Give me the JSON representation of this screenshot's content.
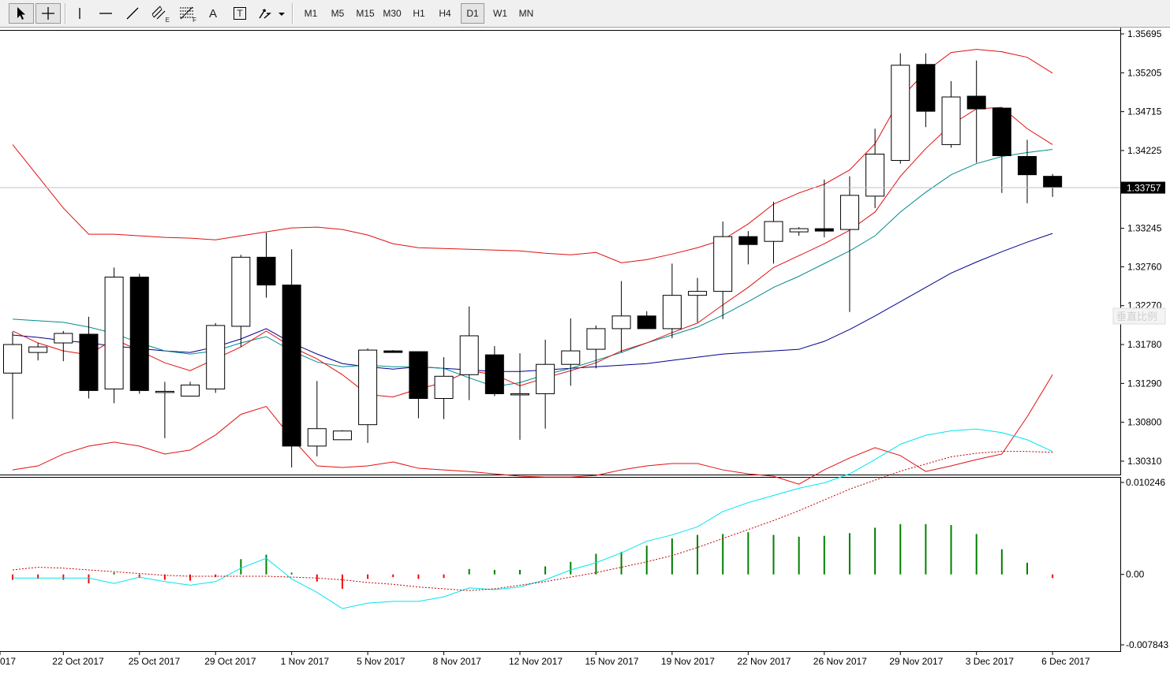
{
  "toolbar": {
    "tools": [
      {
        "name": "cursor-tool",
        "icon": "arrow-cursor-icon"
      },
      {
        "name": "crosshair-tool",
        "icon": "crosshair-icon"
      },
      {
        "name": "vertical-line-tool",
        "icon": "vertical-line-icon"
      },
      {
        "name": "horizontal-line-tool",
        "icon": "horizontal-line-icon"
      },
      {
        "name": "trendline-tool",
        "icon": "trendline-icon"
      },
      {
        "name": "equidistant-channel-tool",
        "icon": "channel-icon",
        "sub": "E"
      },
      {
        "name": "fibonacci-tool",
        "icon": "fibonacci-icon",
        "sub": "F"
      },
      {
        "name": "text-tool",
        "icon": "text-icon",
        "label": "A"
      },
      {
        "name": "text-label-tool",
        "icon": "text-label-icon",
        "label": "T"
      },
      {
        "name": "arrows-tool",
        "icon": "arrows-dropdown-icon"
      }
    ],
    "timeframes": [
      "M1",
      "M5",
      "M15",
      "M30",
      "H1",
      "H4",
      "D1",
      "W1",
      "MN"
    ],
    "active_timeframe": "D1"
  },
  "price_axis": {
    "labels": [
      "1.35695",
      "1.35205",
      "1.34715",
      "1.34225",
      "1.33245",
      "1.32760",
      "1.32270",
      "1.31780",
      "1.31290",
      "1.30800",
      "1.30310"
    ],
    "current_price": "1.33757",
    "watermark": "垂直比例"
  },
  "indicator_axis": {
    "labels": [
      "0.010246",
      "0.00",
      "-0.007843"
    ]
  },
  "time_axis": {
    "labels": [
      "017",
      "22 Oct 2017",
      "25 Oct 2017",
      "29 Oct 2017",
      "1 Nov 2017",
      "5 Nov 2017",
      "8 Nov 2017",
      "12 Nov 2017",
      "15 Nov 2017",
      "19 Nov 2017",
      "22 Nov 2017",
      "26 Nov 2017",
      "29 Nov 2017",
      "3 Dec 2017",
      "6 Dec 2017"
    ]
  },
  "colors": {
    "bollinger": "#e01010",
    "ma_teal": "#008b8b",
    "ma_navy": "#00008b",
    "histogram_up": "#008000",
    "histogram_down": "#ff0000",
    "signal_cyan": "#00e5ee",
    "signal_dotted": "#c00000",
    "bull_candle": "#ffffff",
    "bear_candle": "#000000"
  },
  "chart_data": {
    "type": "candlestick",
    "symbol_timeframe": "D1",
    "ylim": [
      1.3011,
      1.358
    ],
    "candles": [
      {
        "o": 1.3142,
        "h": 1.3194,
        "l": 1.3084,
        "c": 1.3178
      },
      {
        "o": 1.3168,
        "h": 1.318,
        "l": 1.3158,
        "c": 1.3175
      },
      {
        "o": 1.318,
        "h": 1.3195,
        "l": 1.3157,
        "c": 1.3192
      },
      {
        "o": 1.3191,
        "h": 1.3213,
        "l": 1.311,
        "c": 1.312
      },
      {
        "o": 1.3122,
        "h": 1.3275,
        "l": 1.3104,
        "c": 1.3263
      },
      {
        "o": 1.3263,
        "h": 1.3267,
        "l": 1.3116,
        "c": 1.312
      },
      {
        "o": 1.3119,
        "h": 1.3131,
        "l": 1.306,
        "c": 1.3119
      },
      {
        "o": 1.3113,
        "h": 1.3131,
        "l": 1.3113,
        "c": 1.3127
      },
      {
        "o": 1.3122,
        "h": 1.3205,
        "l": 1.3117,
        "c": 1.3202
      },
      {
        "o": 1.3201,
        "h": 1.3291,
        "l": 1.3175,
        "c": 1.3288
      },
      {
        "o": 1.3288,
        "h": 1.3319,
        "l": 1.3237,
        "c": 1.3253
      },
      {
        "o": 1.3253,
        "h": 1.3298,
        "l": 1.3023,
        "c": 1.305
      },
      {
        "o": 1.305,
        "h": 1.3132,
        "l": 1.3037,
        "c": 1.3072
      },
      {
        "o": 1.3058,
        "h": 1.307,
        "l": 1.3058,
        "c": 1.3069
      },
      {
        "o": 1.3077,
        "h": 1.3173,
        "l": 1.3054,
        "c": 1.3171
      },
      {
        "o": 1.317,
        "h": 1.3171,
        "l": 1.3168,
        "c": 1.3168
      },
      {
        "o": 1.3169,
        "h": 1.3169,
        "l": 1.3085,
        "c": 1.311
      },
      {
        "o": 1.311,
        "h": 1.3162,
        "l": 1.3084,
        "c": 1.3138
      },
      {
        "o": 1.314,
        "h": 1.3226,
        "l": 1.3108,
        "c": 1.3189
      },
      {
        "o": 1.3165,
        "h": 1.3176,
        "l": 1.3113,
        "c": 1.3116
      },
      {
        "o": 1.3116,
        "h": 1.3167,
        "l": 1.3058,
        "c": 1.3116
      },
      {
        "o": 1.3116,
        "h": 1.3184,
        "l": 1.3072,
        "c": 1.3153
      },
      {
        "o": 1.3153,
        "h": 1.3211,
        "l": 1.3126,
        "c": 1.317
      },
      {
        "o": 1.3172,
        "h": 1.3202,
        "l": 1.3148,
        "c": 1.3198
      },
      {
        "o": 1.3198,
        "h": 1.3258,
        "l": 1.3168,
        "c": 1.3214
      },
      {
        "o": 1.3214,
        "h": 1.322,
        "l": 1.3198,
        "c": 1.3198
      },
      {
        "o": 1.3198,
        "h": 1.328,
        "l": 1.3186,
        "c": 1.324
      },
      {
        "o": 1.324,
        "h": 1.3262,
        "l": 1.3206,
        "c": 1.3245
      },
      {
        "o": 1.3245,
        "h": 1.3333,
        "l": 1.321,
        "c": 1.3314
      },
      {
        "o": 1.3314,
        "h": 1.3321,
        "l": 1.3279,
        "c": 1.3304
      },
      {
        "o": 1.3308,
        "h": 1.3358,
        "l": 1.328,
        "c": 1.3333
      },
      {
        "o": 1.332,
        "h": 1.3326,
        "l": 1.3315,
        "c": 1.3324
      },
      {
        "o": 1.3324,
        "h": 1.3386,
        "l": 1.3313,
        "c": 1.3321
      },
      {
        "o": 1.3323,
        "h": 1.339,
        "l": 1.3219,
        "c": 1.3366
      },
      {
        "o": 1.3365,
        "h": 1.345,
        "l": 1.335,
        "c": 1.3418
      },
      {
        "o": 1.341,
        "h": 1.3545,
        "l": 1.3406,
        "c": 1.353
      },
      {
        "o": 1.3531,
        "h": 1.3545,
        "l": 1.3452,
        "c": 1.3472
      },
      {
        "o": 1.343,
        "h": 1.351,
        "l": 1.3426,
        "c": 1.349
      },
      {
        "o": 1.3491,
        "h": 1.3536,
        "l": 1.3407,
        "c": 1.3475
      },
      {
        "o": 1.3476,
        "h": 1.3475,
        "l": 1.3369,
        "c": 1.3416
      },
      {
        "o": 1.3415,
        "h": 1.3436,
        "l": 1.3356,
        "c": 1.3392
      },
      {
        "o": 1.339,
        "h": 1.3393,
        "l": 1.3364,
        "c": 1.3376
      }
    ],
    "bollinger_upper": [
      1.343,
      1.339,
      1.335,
      1.3317,
      1.3317,
      1.3315,
      1.3313,
      1.3312,
      1.331,
      1.3315,
      1.332,
      1.3325,
      1.3326,
      1.3323,
      1.3316,
      1.3305,
      1.33,
      1.3299,
      1.3298,
      1.3297,
      1.3296,
      1.3293,
      1.3291,
      1.3294,
      1.3281,
      1.3285,
      1.3292,
      1.33,
      1.331,
      1.333,
      1.3355,
      1.3369,
      1.338,
      1.3398,
      1.3431,
      1.3488,
      1.3522,
      1.3546,
      1.355,
      1.3547,
      1.354,
      1.352
    ],
    "bollinger_middle": [
      1.319,
      1.3187,
      1.3183,
      1.318,
      1.3176,
      1.3173,
      1.317,
      1.3168,
      1.3175,
      1.3185,
      1.3198,
      1.318,
      1.3166,
      1.3154,
      1.315,
      1.3147,
      1.315,
      1.3148,
      1.3146,
      1.3144,
      1.3144,
      1.3146,
      1.3148,
      1.315,
      1.3152,
      1.3154,
      1.3158,
      1.3162,
      1.3166,
      1.3168,
      1.317,
      1.3172,
      1.3182,
      1.3197,
      1.3214,
      1.3232,
      1.325,
      1.3268,
      1.3282,
      1.3295,
      1.3307,
      1.3318
    ],
    "bollinger_lower": [
      1.302,
      1.3025,
      1.304,
      1.305,
      1.3055,
      1.305,
      1.304,
      1.3045,
      1.3064,
      1.309,
      1.31,
      1.306,
      1.3025,
      1.3023,
      1.3025,
      1.303,
      1.3022,
      1.302,
      1.3018,
      1.3015,
      1.3012,
      1.3011,
      1.3011,
      1.3013,
      1.302,
      1.3025,
      1.3028,
      1.3028,
      1.302,
      1.3015,
      1.3012,
      1.3002,
      1.302,
      1.3035,
      1.3048,
      1.3038,
      1.3018,
      1.3025,
      1.3033,
      1.304,
      1.3087,
      1.314
    ],
    "ma_teal": [
      1.321,
      1.3208,
      1.3206,
      1.32,
      1.3192,
      1.318,
      1.317,
      1.3166,
      1.317,
      1.318,
      1.3188,
      1.317,
      1.3156,
      1.315,
      1.3152,
      1.315,
      1.315,
      1.3148,
      1.3136,
      1.3125,
      1.313,
      1.314,
      1.3148,
      1.3158,
      1.3168,
      1.318,
      1.319,
      1.32,
      1.3215,
      1.3232,
      1.325,
      1.3264,
      1.328,
      1.3296,
      1.3315,
      1.3345,
      1.337,
      1.3392,
      1.3406,
      1.3415,
      1.342,
      1.3424
    ],
    "ma_red": [
      1.3195,
      1.318,
      1.317,
      1.3165,
      1.3185,
      1.317,
      1.3155,
      1.3145,
      1.316,
      1.3175,
      1.3195,
      1.3175,
      1.316,
      1.314,
      1.3115,
      1.3112,
      1.3122,
      1.313,
      1.3145,
      1.314,
      1.3126,
      1.3136,
      1.3145,
      1.3155,
      1.317,
      1.318,
      1.3193,
      1.3205,
      1.3228,
      1.325,
      1.3275,
      1.329,
      1.3305,
      1.3322,
      1.3345,
      1.339,
      1.3425,
      1.3455,
      1.3475,
      1.3477,
      1.345,
      1.343
    ],
    "indicator_ylim": [
      -0.007843,
      0.010246
    ],
    "histogram": [
      -0.0006,
      -0.0005,
      -0.0006,
      -0.001,
      0.0002,
      -0.0004,
      -0.0006,
      -0.0007,
      -0.0003,
      0.0017,
      0.0022,
      0.0002,
      -0.0008,
      -0.0016,
      -0.0005,
      -0.0003,
      -0.0005,
      -0.0004,
      0.0006,
      0.0005,
      0.0005,
      0.0009,
      0.0014,
      0.0023,
      0.0025,
      0.0032,
      0.004,
      0.0044,
      0.0045,
      0.0047,
      0.0044,
      0.0042,
      0.0043,
      0.0046,
      0.0052,
      0.0056,
      0.0056,
      0.0055,
      0.0045,
      0.0028,
      0.0013,
      -0.0004
    ],
    "signal_cyan": [
      -0.0004,
      -0.0004,
      -0.0004,
      -0.0004,
      -0.001,
      -0.0003,
      -0.0008,
      -0.0012,
      -0.0008,
      0.0007,
      0.0018,
      -0.0005,
      -0.002,
      -0.0038,
      -0.0032,
      -0.003,
      -0.003,
      -0.0025,
      -0.0015,
      -0.0017,
      -0.0014,
      -0.0006,
      0.0005,
      0.0013,
      0.0024,
      0.0037,
      0.0044,
      0.0053,
      0.007,
      0.008,
      0.0088,
      0.0096,
      0.0102,
      0.0112,
      0.0128,
      0.0145,
      0.0155,
      0.016,
      0.0162,
      0.0158,
      0.015,
      0.0137
    ],
    "signal_dotted": [
      0.0005,
      0.0008,
      0.0007,
      0.0005,
      0.0003,
      0.0001,
      -0.0001,
      -0.0002,
      -0.0002,
      -0.0002,
      -0.0002,
      -0.0003,
      -0.0004,
      -0.0006,
      -0.0009,
      -0.0011,
      -0.0014,
      -0.0016,
      -0.0018,
      -0.0016,
      -0.0012,
      -0.0008,
      -0.0003,
      0.0002,
      0.0008,
      0.0014,
      0.0021,
      0.003,
      0.004,
      0.005,
      0.006,
      0.0071,
      0.0083,
      0.0095,
      0.0105,
      0.0115,
      0.0123,
      0.0131,
      0.0135,
      0.0137,
      0.0137,
      0.0136
    ]
  }
}
